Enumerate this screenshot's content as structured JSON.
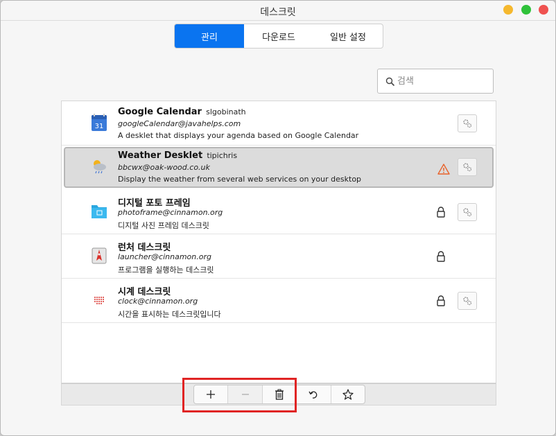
{
  "window": {
    "title": "데스크릿"
  },
  "tabs": [
    {
      "label": "관리",
      "active": true
    },
    {
      "label": "다운로드",
      "active": false
    },
    {
      "label": "일반 설정",
      "active": false
    }
  ],
  "search": {
    "placeholder": "검색",
    "value": ""
  },
  "desklets": [
    {
      "name": "Google Calendar",
      "author": "slgobinath",
      "uuid": "googleCalendar@javahelps.com",
      "description": "A desklet that displays your agenda based on Google Calendar",
      "icon": "calendar-icon",
      "icon_text": "31",
      "locked": false,
      "warning": false,
      "configurable": true,
      "selected": false
    },
    {
      "name": "Weather Desklet",
      "author": "tipichris",
      "uuid": "bbcwx@oak-wood.co.uk",
      "description": "Display the weather from several web services on your desktop",
      "icon": "weather-icon",
      "locked": false,
      "warning": true,
      "configurable": true,
      "selected": true
    },
    {
      "name": "디지털 포토 프레임",
      "author": "",
      "uuid": "photoframe@cinnamon.org",
      "description": "디지털 사진 프레임 데스크릿",
      "icon": "folder-icon",
      "locked": true,
      "warning": false,
      "configurable": true,
      "selected": false
    },
    {
      "name": "런처 데스크릿",
      "author": "",
      "uuid": "launcher@cinnamon.org",
      "description": "프로그램을 실행하는 데스크릿",
      "icon": "launcher-icon",
      "locked": true,
      "warning": false,
      "configurable": false,
      "selected": false
    },
    {
      "name": "시계 데스크릿",
      "author": "",
      "uuid": "clock@cinnamon.org",
      "description": "시간을 표시하는 데스크릿입니다",
      "icon": "clock-icon",
      "locked": true,
      "warning": false,
      "configurable": true,
      "selected": false
    }
  ],
  "toolbar": [
    {
      "icon": "plus-icon",
      "enabled": true
    },
    {
      "icon": "minus-icon",
      "enabled": false
    },
    {
      "icon": "trash-icon",
      "enabled": true
    },
    {
      "icon": "undo-icon",
      "enabled": true
    },
    {
      "icon": "pin-icon",
      "enabled": true
    }
  ],
  "colors": {
    "accent": "#0a74f0",
    "warning": "#e8622a",
    "highlight": "#e02424"
  }
}
